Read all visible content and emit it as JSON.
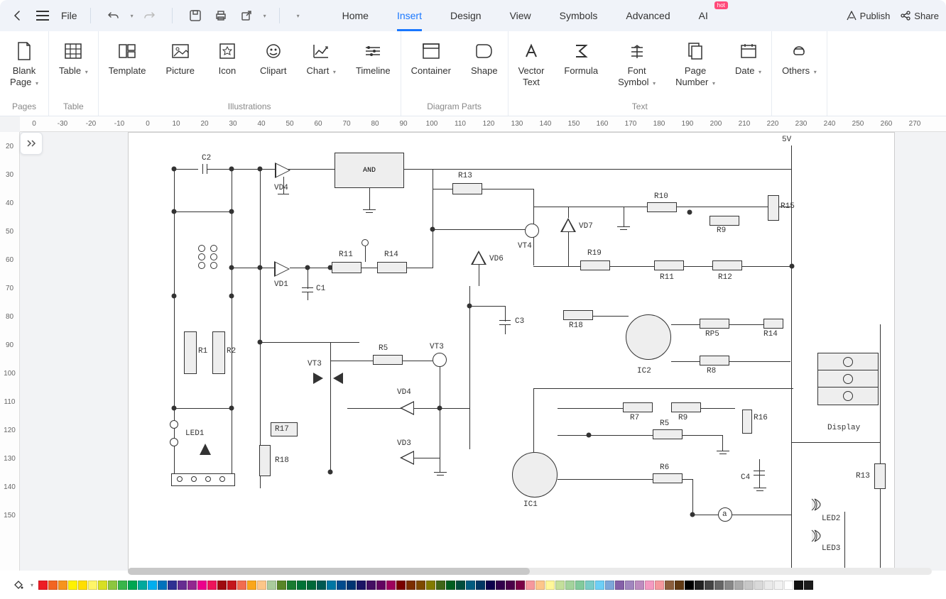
{
  "header": {
    "file_label": "File",
    "tabs": [
      "Home",
      "Insert",
      "Design",
      "View",
      "Symbols",
      "Advanced",
      "AI"
    ],
    "active_tab": "Insert",
    "hot_label": "hot",
    "publish": "Publish",
    "share": "Share"
  },
  "ribbon": {
    "groups": [
      {
        "caption": "Pages",
        "buttons": [
          {
            "label": "Blank\nPage",
            "icon": "blank-page-icon",
            "dropdown": true
          }
        ]
      },
      {
        "caption": "Table",
        "buttons": [
          {
            "label": "Table",
            "icon": "table-icon",
            "dropdown": true
          }
        ]
      },
      {
        "caption": "Illustrations",
        "buttons": [
          {
            "label": "Template",
            "icon": "template-icon"
          },
          {
            "label": "Picture",
            "icon": "picture-icon"
          },
          {
            "label": "Icon",
            "icon": "icon-icon"
          },
          {
            "label": "Clipart",
            "icon": "clipart-icon"
          },
          {
            "label": "Chart",
            "icon": "chart-icon",
            "dropdown": true
          },
          {
            "label": "Timeline",
            "icon": "timeline-icon"
          }
        ]
      },
      {
        "caption": "Diagram Parts",
        "buttons": [
          {
            "label": "Container",
            "icon": "container-icon"
          },
          {
            "label": "Shape",
            "icon": "shape-icon"
          }
        ]
      },
      {
        "caption": "Text",
        "buttons": [
          {
            "label": "Vector\nText",
            "icon": "vector-text-icon"
          },
          {
            "label": "Formula",
            "icon": "formula-icon"
          },
          {
            "label": "Font\nSymbol",
            "icon": "font-symbol-icon",
            "dropdown": true
          },
          {
            "label": "Page\nNumber",
            "icon": "page-number-icon",
            "dropdown": true
          },
          {
            "label": "Date",
            "icon": "date-icon",
            "dropdown": true
          }
        ]
      },
      {
        "caption": "",
        "buttons": [
          {
            "label": "Others",
            "icon": "others-icon",
            "dropdown": true
          }
        ]
      }
    ]
  },
  "rulers": {
    "h": [
      "0",
      "-30",
      "-20",
      "-10",
      "0",
      "10",
      "20",
      "30",
      "40",
      "50",
      "60",
      "70",
      "80",
      "90",
      "100",
      "110",
      "120",
      "130",
      "140",
      "150",
      "160",
      "170",
      "180",
      "190",
      "200",
      "210",
      "220",
      "230",
      "240",
      "250",
      "260",
      "270"
    ],
    "v": [
      "20",
      "30",
      "40",
      "50",
      "60",
      "70",
      "80",
      "90",
      "100",
      "110",
      "120",
      "130",
      "140",
      "150"
    ]
  },
  "circuit": {
    "and": "AND",
    "labels": {
      "c2": "C2",
      "vd4": "VD4",
      "vd4b": "VD4",
      "vd1": "VD1",
      "c1": "C1",
      "r11": "R11",
      "r14": "R14",
      "r13": "R13",
      "vd6": "VD6",
      "vt4": "VT4",
      "vd7": "VD7",
      "r10": "R10",
      "r9": "R9",
      "r9b": "R9",
      "r15": "R15",
      "r19": "R19",
      "r11b": "R11",
      "r12": "R12",
      "c3": "C3",
      "r18": "R18",
      "r18b": "R18",
      "ic2": "IC2",
      "rp5": "RP5",
      "r14b": "R14",
      "r8": "R8",
      "r5": "R5",
      "r5b": "R5",
      "vt3": "VT3",
      "vt3b": "VT3",
      "vd3": "VD3",
      "display": "Display",
      "r7": "R7",
      "r16": "R16",
      "r6": "R6",
      "c4": "C4",
      "r13b": "R13",
      "led1": "LED1",
      "led2": "LED2",
      "led3": "LED3",
      "r1": "R1",
      "r2": "R2",
      "r17": "R17",
      "ic1": "IC1",
      "a": "a",
      "v5": "5V"
    }
  },
  "colors": [
    "#ed1c24",
    "#f26522",
    "#f7941d",
    "#fff200",
    "#ffde00",
    "#fff568",
    "#d7df23",
    "#8dc63f",
    "#39b54a",
    "#00a651",
    "#00a99d",
    "#00aeef",
    "#0072bc",
    "#2e3192",
    "#662d91",
    "#92278f",
    "#ec008c",
    "#ed145b",
    "#9e0b0f",
    "#c4161c",
    "#f26c4f",
    "#faa61a",
    "#fdc689",
    "#aacb9d",
    "#598527",
    "#197b30",
    "#007236",
    "#006838",
    "#005952",
    "#0076a3",
    "#004b8d",
    "#003471",
    "#1b1464",
    "#440e62",
    "#630460",
    "#9e005d",
    "#790000",
    "#7b2e00",
    "#7d4900",
    "#827b00",
    "#406618",
    "#005e20",
    "#004d3d",
    "#005b7f",
    "#003663",
    "#0d004c",
    "#32004b",
    "#4b0049",
    "#7b0046",
    "#f6989d",
    "#fdc68a",
    "#fff799",
    "#c4df9b",
    "#a3d39c",
    "#82ca9c",
    "#7accc8",
    "#6dcff6",
    "#7da7d9",
    "#8560a8",
    "#a186be",
    "#bd8cbf",
    "#f49ac1",
    "#f5989d",
    "#8b5e3c",
    "#603913",
    "#000000",
    "#222222",
    "#444444",
    "#666666",
    "#888888",
    "#aaaaaa",
    "#c7c7c7",
    "#d9d9d9",
    "#eaeaea",
    "#f2f2f2",
    "#ffffff",
    "#111111",
    "#1c1c1c"
  ]
}
